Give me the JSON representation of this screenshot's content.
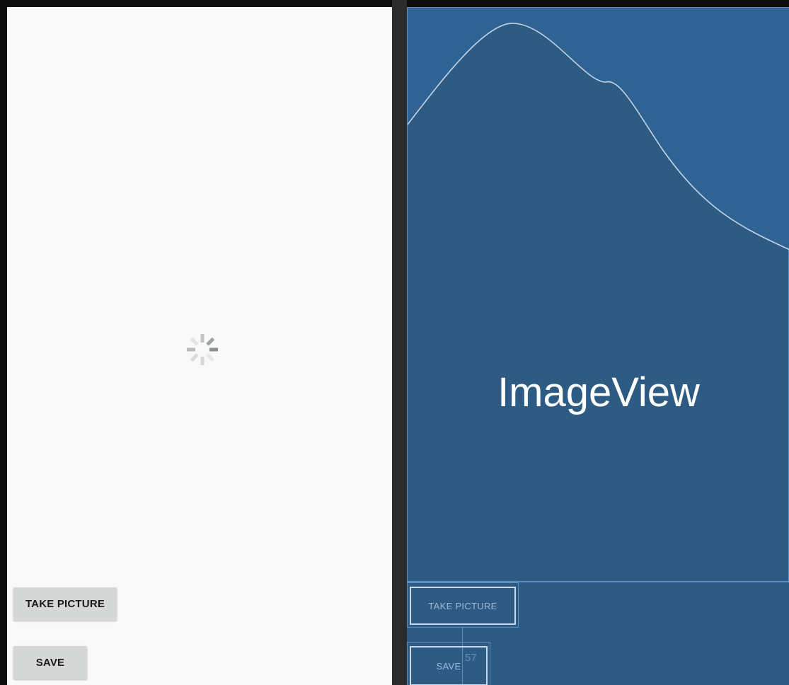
{
  "design": {
    "take_picture_label": "TAKE PICTURE",
    "save_label": "SAVE"
  },
  "blueprint": {
    "image_label": "ImageView",
    "take_picture_label": "TAKE PICTURE",
    "save_label": "SAVE",
    "measure_label": "57"
  },
  "colors": {
    "design_bg": "#f9f9f9",
    "blueprint_bg": "#2d5b84",
    "blueprint_line": "#5c8ec0",
    "button_bg": "#d6d7d7"
  },
  "icons": {
    "loading": "loading-spinner-icon"
  }
}
